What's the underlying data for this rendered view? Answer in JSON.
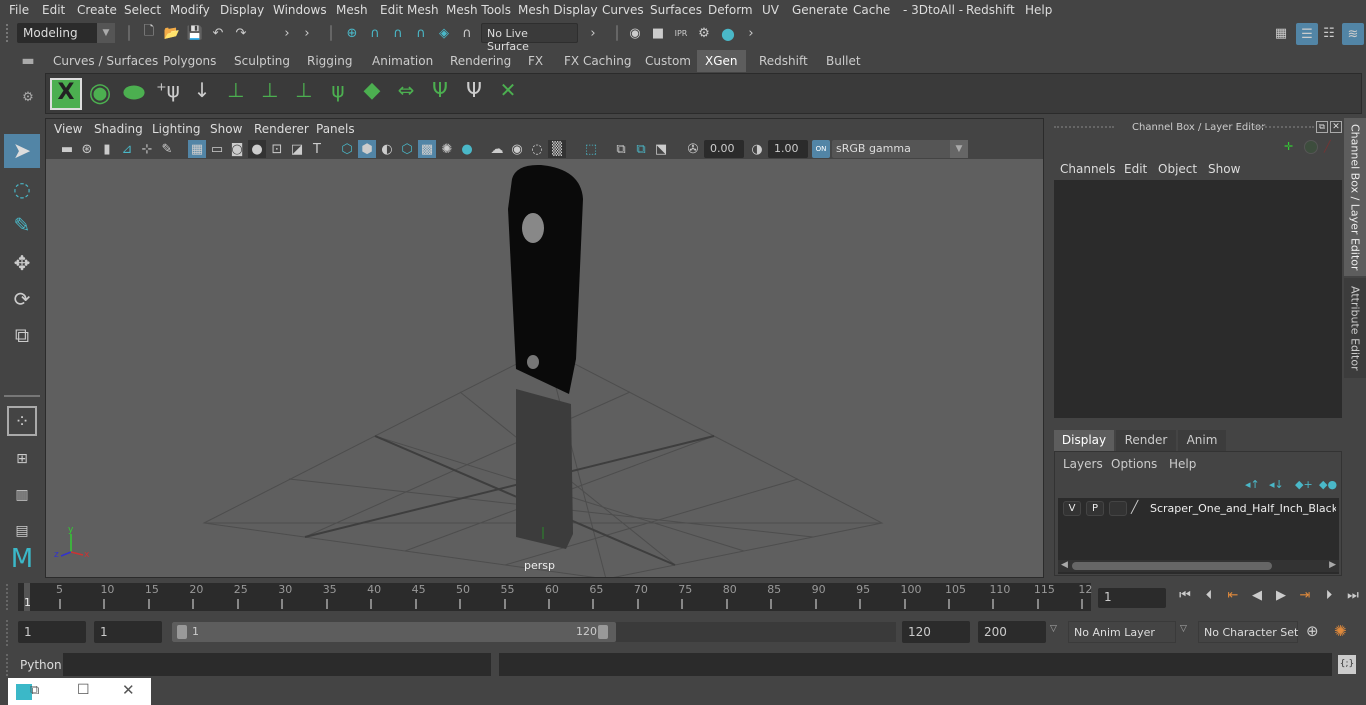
{
  "menubar": {
    "items": [
      "File",
      "Edit",
      "Create",
      "Select",
      "Modify",
      "Display",
      "Windows",
      "Mesh",
      "Edit Mesh",
      "Mesh Tools",
      "Mesh Display",
      "Curves",
      "Surfaces",
      "Deform",
      "UV",
      "Generate",
      "Cache",
      "- 3DtoAll -",
      "Redshift",
      "Help"
    ]
  },
  "statusline": {
    "workspace": "Modeling",
    "live_surface": "No Live Surface"
  },
  "shelf": {
    "tabs": [
      "Curves / Surfaces",
      "Polygons",
      "Sculpting",
      "Rigging",
      "Animation",
      "Rendering",
      "FX",
      "FX Caching",
      "Custom",
      "XGen",
      "Redshift",
      "Bullet"
    ],
    "active_tab": "XGen"
  },
  "viewport": {
    "menu": [
      "View",
      "Shading",
      "Lighting",
      "Show",
      "Renderer",
      "Panels"
    ],
    "exposure": "0.00",
    "gamma": "1.00",
    "colorspace_toggle": "ON",
    "colorspace": "sRGB gamma",
    "camera_label": "persp",
    "axis": {
      "x": "x",
      "y": "y",
      "z": "z"
    }
  },
  "channelbox": {
    "title": "Channel Box / Layer Editor",
    "menu": [
      "Channels",
      "Edit",
      "Object",
      "Show"
    ]
  },
  "layereditor": {
    "tabs": [
      "Display",
      "Render",
      "Anim"
    ],
    "active_tab": "Display",
    "menu": [
      "Layers",
      "Options",
      "Help"
    ],
    "layers": [
      {
        "v": "V",
        "p": "P",
        "name": "Scraper_One_and_Half_Inch_Black_Ha"
      }
    ]
  },
  "sidetabs": [
    "Channel Box / Layer Editor",
    "Attribute Editor"
  ],
  "timeline": {
    "current_frame_marker": "1",
    "ticks": [
      "5",
      "10",
      "15",
      "20",
      "25",
      "30",
      "35",
      "40",
      "45",
      "50",
      "55",
      "60",
      "65",
      "70",
      "75",
      "80",
      "85",
      "90",
      "95",
      "100",
      "105",
      "110",
      "115",
      "12"
    ],
    "current_frame": "1"
  },
  "range": {
    "start": "1",
    "playback_start": "1",
    "slider_start": "1",
    "slider_end": "120",
    "playback_end": "120",
    "end": "200",
    "anim_layer": "No Anim Layer",
    "character_set": "No Character Set"
  },
  "cmdline": {
    "label": "Python",
    "value": ""
  }
}
